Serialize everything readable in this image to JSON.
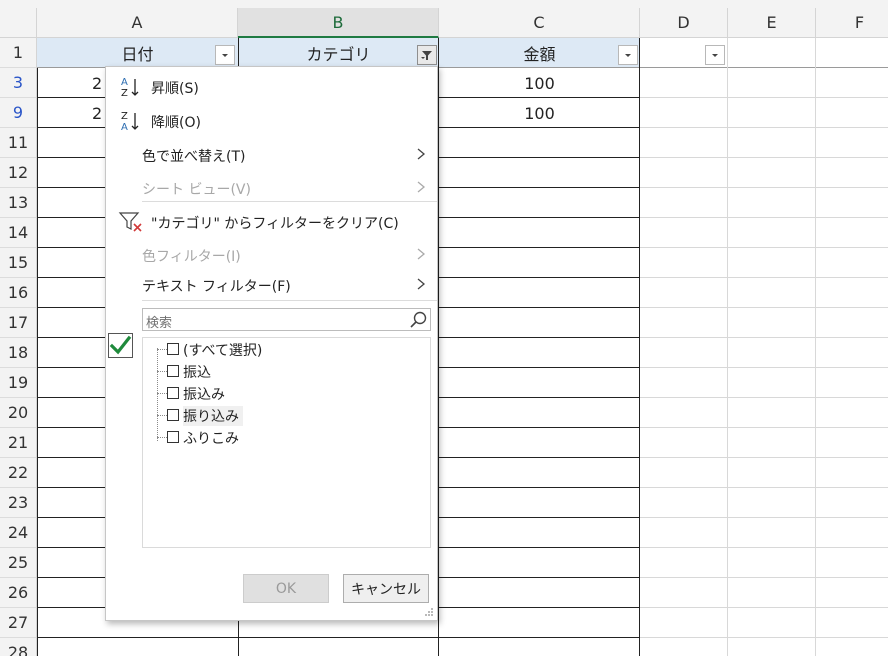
{
  "columns": [
    "A",
    "B",
    "C",
    "D",
    "E",
    "F"
  ],
  "rows": [
    "1",
    "3",
    "9",
    "11",
    "12",
    "13",
    "14",
    "15",
    "16",
    "17",
    "18",
    "19",
    "20",
    "21",
    "22",
    "23",
    "24",
    "25",
    "26",
    "27",
    "28"
  ],
  "header_row": {
    "col_a": "日付",
    "col_b": "カテゴリ",
    "col_c": "金額"
  },
  "cells": {
    "a3_partial": "2",
    "a9_partial": "2",
    "c3": "100",
    "c9": "100"
  },
  "filter_menu": {
    "sort_asc": "昇順(S)",
    "sort_desc": "降順(O)",
    "sort_by_color": "色で並べ替え(T)",
    "sheet_view": "シート ビュー(V)",
    "clear_filter": "\"カテゴリ\" からフィルターをクリア(C)",
    "color_filter": "色フィルター(I)",
    "text_filter": "テキスト フィルター(F)",
    "search_placeholder": "検索",
    "items": [
      "(すべて選択)",
      "振込",
      "振込み",
      "振り込み",
      "ふりこみ"
    ],
    "ok_label": "OK",
    "cancel_label": "キャンセル"
  },
  "colors": {
    "header_band": "#dde9f5",
    "selected_col_text": "#1d6b3a",
    "filtered_row_number": "#2a55c8",
    "check_green": "#1f8a3c"
  }
}
